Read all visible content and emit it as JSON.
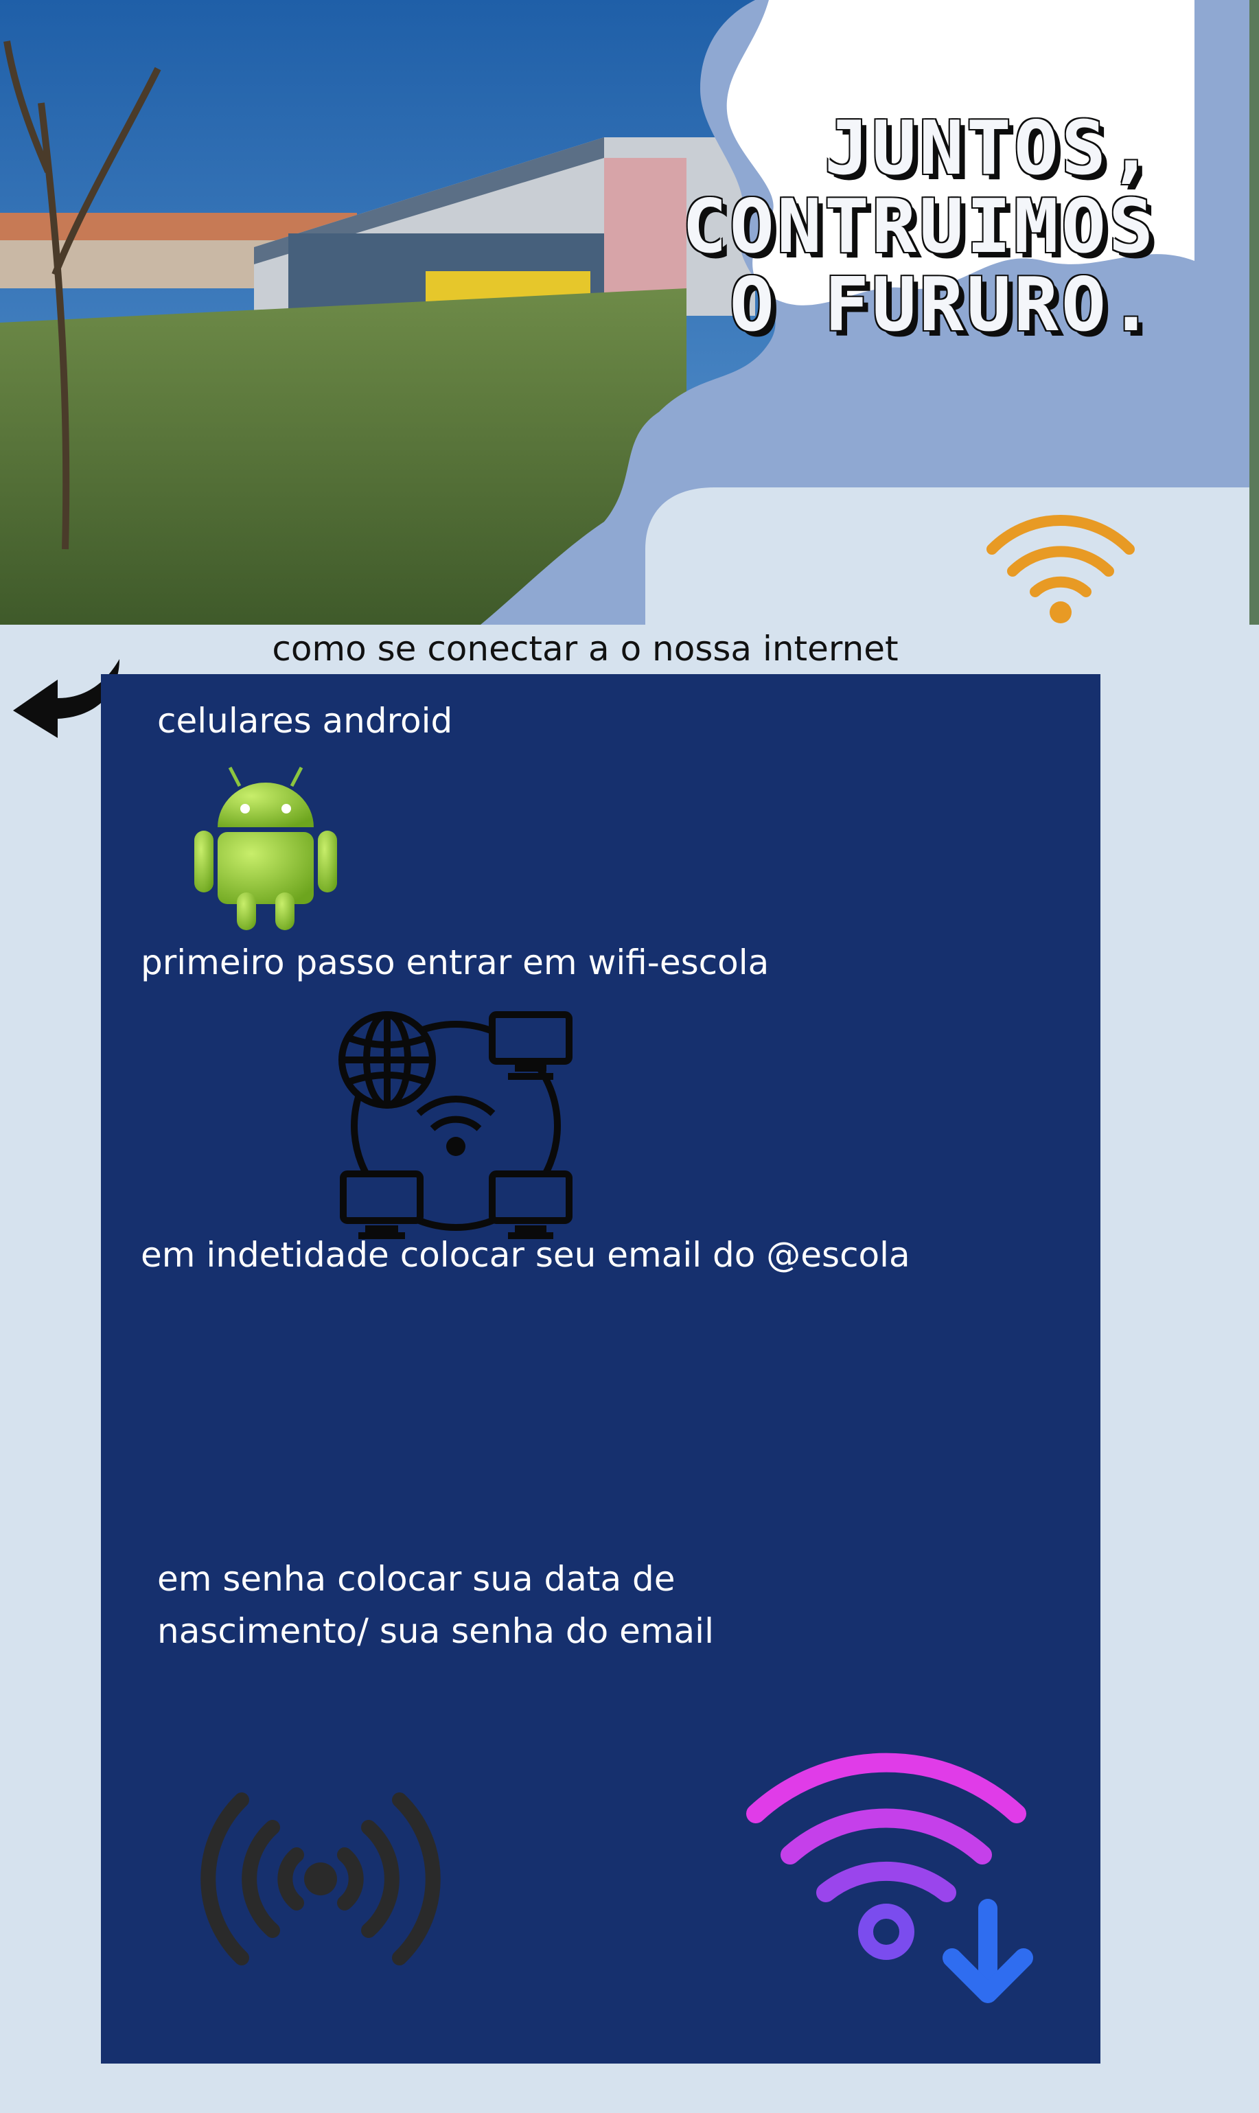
{
  "headline": {
    "line1": "JUNTOS,",
    "line2": "CONTRUIMOS",
    "line3": "O FURURO."
  },
  "subtitle": "como se conectar a o nossa internet",
  "steps": {
    "device": "celulares android",
    "step1": "primeiro passo entrar em wifi-escola",
    "step2": "em indetidade colocar seu email do @escola",
    "step3_line1": "em senha colocar sua data de",
    "step3_line2": "nascimento/ sua senha do email"
  },
  "icons": {
    "header": "wifi-icon",
    "back": "curved-arrow-icon",
    "device": "android-robot-icon",
    "network": "network-globe-icon",
    "broadcast": "broadcast-signal-icon",
    "download": "wifi-download-icon"
  },
  "colors": {
    "background": "#d6e2ee",
    "panel": "#16306e",
    "hero_overlay": "#8fa8d2",
    "wifi_orange": "#e89a24",
    "android_green": "#8cc63f",
    "gradient_magenta": "#e03ce8",
    "gradient_blue": "#2f6df0"
  }
}
